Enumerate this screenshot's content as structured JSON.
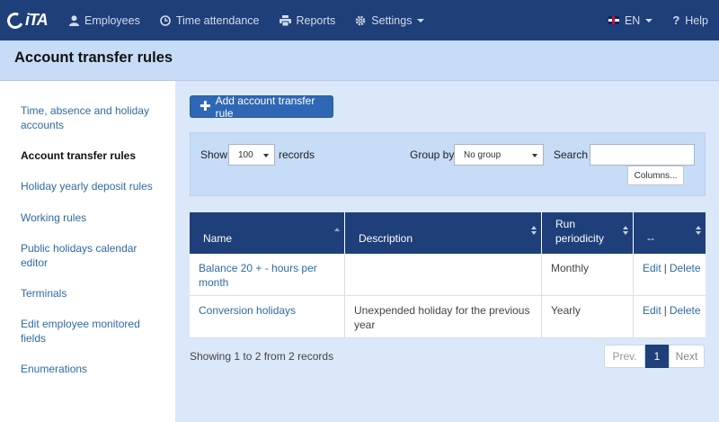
{
  "app": {
    "logo_text": "iTA"
  },
  "nav": {
    "employees": "Employees",
    "time_attendance": "Time attendance",
    "reports": "Reports",
    "settings": "Settings",
    "language": "EN",
    "help": "Help"
  },
  "page": {
    "title": "Account transfer rules"
  },
  "sidebar": {
    "items": [
      {
        "label": "Time, absence and holiday accounts"
      },
      {
        "label": "Account transfer rules"
      },
      {
        "label": "Holiday yearly deposit rules"
      },
      {
        "label": "Working rules"
      },
      {
        "label": "Public holidays calendar editor"
      },
      {
        "label": "Terminals"
      },
      {
        "label": "Edit employee monitored fields"
      },
      {
        "label": "Enumerations"
      }
    ]
  },
  "toolbar": {
    "add_label": "Add account transfer rule"
  },
  "filters": {
    "show_label": "Show",
    "records_value": "100",
    "records_label": "records",
    "group_by_label": "Group by",
    "group_by_value": "No group",
    "search_label": "Search",
    "search_value": "",
    "columns_label": "Columns..."
  },
  "table": {
    "columns": [
      {
        "label": "Name"
      },
      {
        "label": "Description"
      },
      {
        "label": "Run periodicity"
      },
      {
        "label": "--"
      }
    ],
    "rows": [
      {
        "name": "Balance 20 + - hours per month",
        "description": "",
        "periodicity": "Monthly"
      },
      {
        "name": "Conversion holidays",
        "description": "Unexpended holiday for the previous year",
        "periodicity": "Yearly"
      }
    ],
    "edit_label": "Edit",
    "separator": "|",
    "delete_label": "Delete"
  },
  "footer": {
    "showing": "Showing 1 to 2 from 2 records",
    "prev": "Prev.",
    "current_page": "1",
    "next": "Next"
  },
  "colors": {
    "navbar": "#1e3f79",
    "accent": "#2e68b4",
    "header_bg": "#c6dcf7",
    "link": "#2f6aa3"
  }
}
